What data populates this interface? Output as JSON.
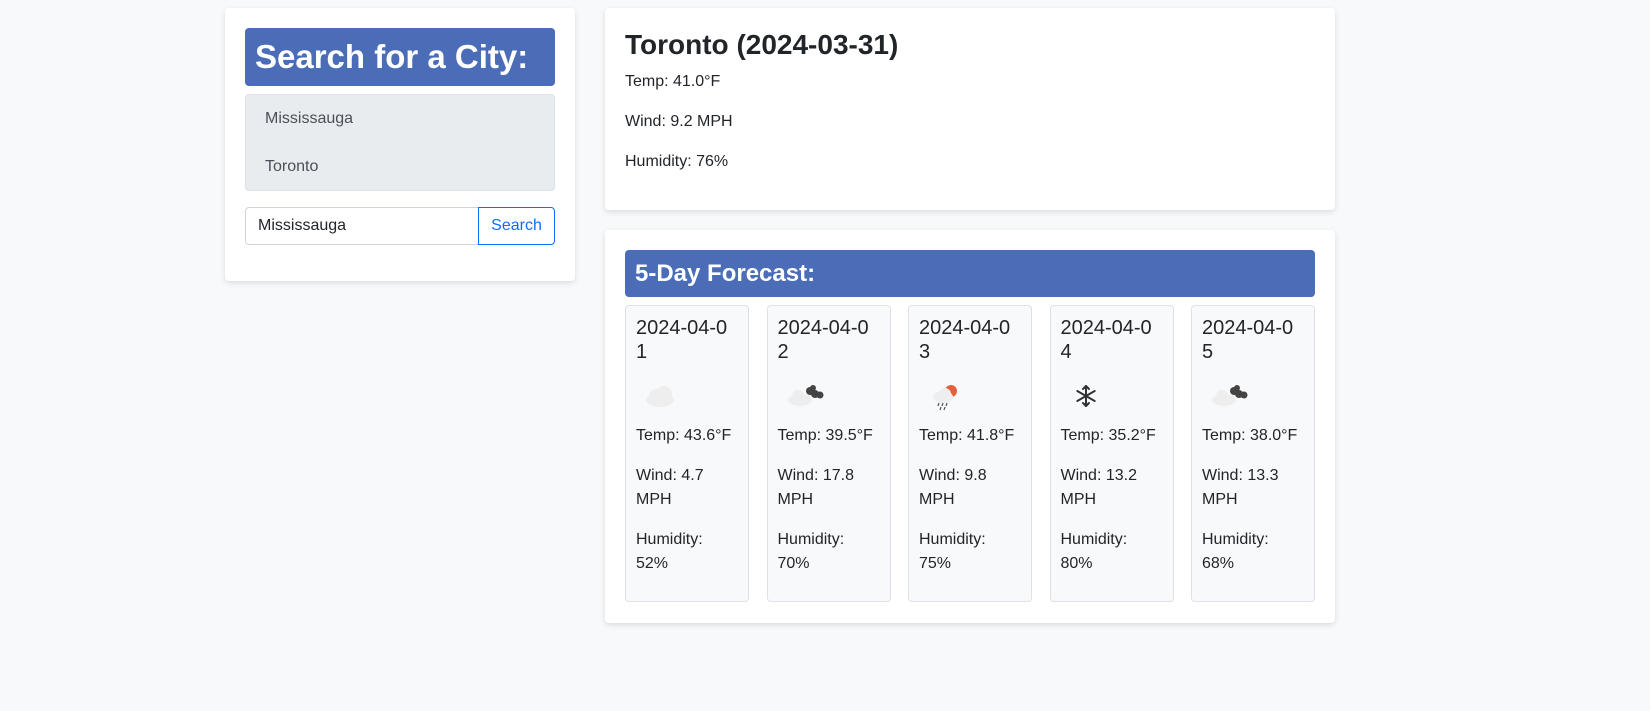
{
  "search": {
    "heading": "Search for a City:",
    "history": [
      "Mississauga",
      "Toronto"
    ],
    "input_value": "Mississauga",
    "button_label": "Search"
  },
  "current": {
    "title": "Toronto (2024-03-31)",
    "temp": "Temp: 41.0°F",
    "wind": "Wind: 9.2 MPH",
    "humidity": "Humidity: 76%"
  },
  "forecast": {
    "heading": "5-Day Forecast:",
    "days": [
      {
        "date": "2024-04-01",
        "icon": "cloud-icon",
        "temp": "Temp: 43.6°F",
        "wind": "Wind: 4.7 MPH",
        "humidity": "Humidity: 52%"
      },
      {
        "date": "2024-04-02",
        "icon": "broken-clouds-icon",
        "temp": "Temp: 39.5°F",
        "wind": "Wind: 17.8 MPH",
        "humidity": "Humidity: 70%"
      },
      {
        "date": "2024-04-03",
        "icon": "rain-sun-icon",
        "temp": "Temp: 41.8°F",
        "wind": "Wind: 9.8 MPH",
        "humidity": "Humidity: 75%"
      },
      {
        "date": "2024-04-04",
        "icon": "snowflake-icon",
        "temp": "Temp: 35.2°F",
        "wind": "Wind: 13.2 MPH",
        "humidity": "Humidity: 80%"
      },
      {
        "date": "2024-04-05",
        "icon": "broken-clouds-icon",
        "temp": "Temp: 38.0°F",
        "wind": "Wind: 13.3 MPH",
        "humidity": "Humidity: 68%"
      }
    ]
  },
  "colors": {
    "banner": "#4b6cb7",
    "page_bg": "#f8f9fa",
    "button_accent": "#0d6efd"
  }
}
